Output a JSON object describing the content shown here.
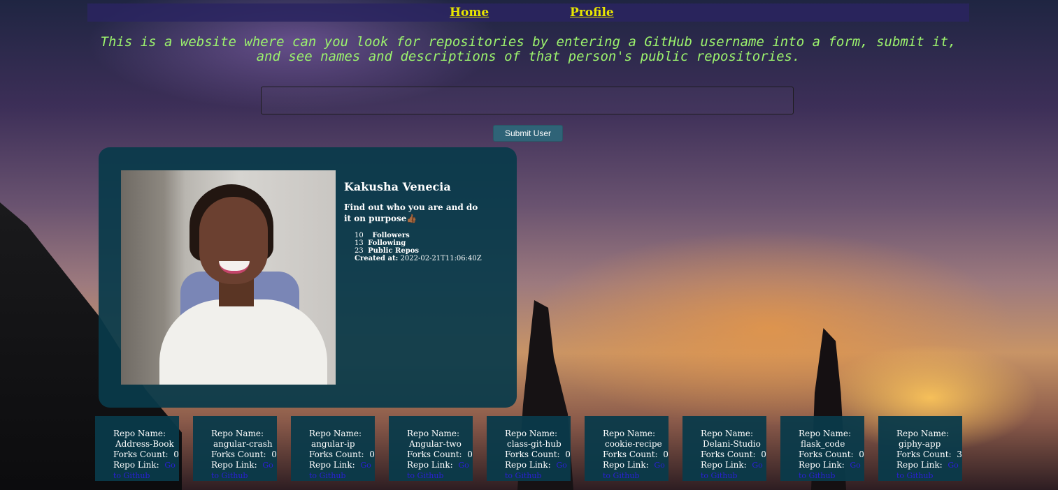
{
  "nav": {
    "home_label": "Home",
    "profile_label": "Profile"
  },
  "intro": "This is a website where can you look for repositories by entering a GitHub username into a form, submit it, and see names and descriptions of that person's public repositories.",
  "search": {
    "value": "",
    "placeholder": ""
  },
  "submit_label": "Submit User",
  "profile": {
    "name": "Kakusha Venecia",
    "bio": "Find out who you are and do it on purpose👍🏾",
    "followers_count": "10",
    "followers_label": "Followers",
    "following_count": "13",
    "following_label": "Following",
    "repos_count": "23",
    "repos_label": "Public Repos",
    "created_label": "Created at:",
    "created_value": "2022-02-21T11:06:40Z"
  },
  "repo_labels": {
    "name": "Repo Name:",
    "forks": "Forks Count:",
    "link": "Repo Link:",
    "link_text": "Go to Github"
  },
  "repos": [
    {
      "name": "Address-Book",
      "forks": "0"
    },
    {
      "name": "angular-crash",
      "forks": "0"
    },
    {
      "name": "angular-ip",
      "forks": "0"
    },
    {
      "name": "Angular-two",
      "forks": "0"
    },
    {
      "name": "class-git-hub",
      "forks": "0"
    },
    {
      "name": "cookie-recipe",
      "forks": "0"
    },
    {
      "name": "Delani-Studio",
      "forks": "0"
    },
    {
      "name": "flask_code",
      "forks": "0"
    },
    {
      "name": "giphy-app",
      "forks": "3"
    }
  ],
  "colors": {
    "nav_link": "#e8e600",
    "intro_text": "#9cf36d",
    "card_bg": "#093a4a",
    "button_bg": "#2f6377",
    "repo_link": "#2b1fd6"
  }
}
